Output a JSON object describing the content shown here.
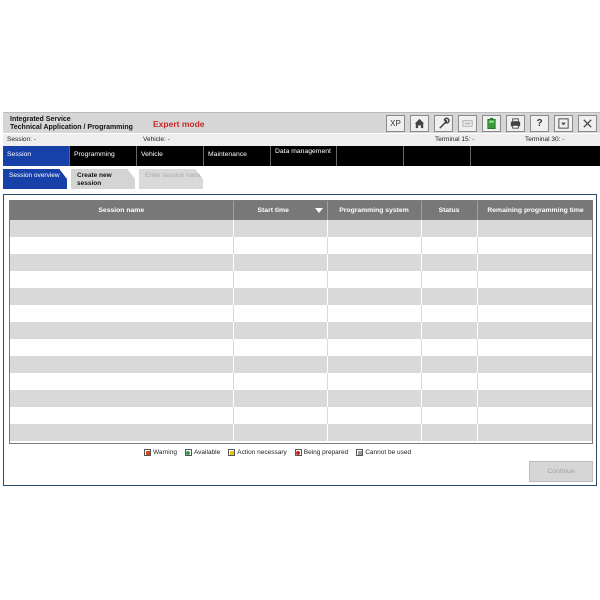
{
  "app": {
    "title_line1": "Integrated Service",
    "title_line2": "Technical Application / Programming",
    "mode": "Expert mode"
  },
  "toolbar": {
    "buttons": [
      {
        "name": "xp-button",
        "label": "XP",
        "icon": "xp-icon"
      },
      {
        "name": "home-button",
        "icon": "home-icon"
      },
      {
        "name": "settings-button",
        "icon": "wrench-icon"
      },
      {
        "name": "card-button",
        "icon": "card-icon",
        "disabled": true
      },
      {
        "name": "battery-button",
        "icon": "battery-icon",
        "color": "#3a9a3a"
      },
      {
        "name": "print-button",
        "icon": "printer-icon"
      },
      {
        "name": "help-button",
        "label": "?",
        "icon": "help-icon"
      },
      {
        "name": "minimize-button",
        "icon": "minimize-icon"
      },
      {
        "name": "close-button",
        "icon": "close-icon"
      }
    ]
  },
  "status": {
    "session": "Session:  -",
    "vehicle": "Vehicle:  -",
    "terminal15": "Terminal 15:  -",
    "terminal30": "Terminal 30:  -"
  },
  "nav": {
    "tabs": [
      {
        "label": "Session",
        "active": true
      },
      {
        "label": "Programming"
      },
      {
        "label": "Vehicle"
      },
      {
        "label": "Maintenance"
      },
      {
        "label": "Data management"
      },
      {
        "label": ""
      },
      {
        "label": ""
      },
      {
        "label": ""
      }
    ]
  },
  "subtabs": {
    "overview": "Session overview",
    "create": "Create new session",
    "enter_name": "Enter session name"
  },
  "table": {
    "columns": [
      "Session name",
      "Start time",
      "Programming system",
      "Status",
      "Remaining programming time"
    ],
    "sorted_column": "Start time",
    "row_count": 13
  },
  "legend": {
    "items": [
      {
        "label": "Warning",
        "color": "#d24a1a"
      },
      {
        "label": "Available",
        "color": "#2e9e4a"
      },
      {
        "label": "Action necessary",
        "color": "#e8c21a"
      },
      {
        "label": "Being prepared",
        "color": "#cc2020"
      },
      {
        "label": "Cannot be used",
        "color": "#9a9a9a"
      }
    ]
  },
  "buttons": {
    "continue": "Continue"
  },
  "colors": {
    "accent": "#1740a8",
    "mode_red": "#c8282a",
    "header_bg": "#d6d6d6",
    "table_header": "#787878"
  }
}
